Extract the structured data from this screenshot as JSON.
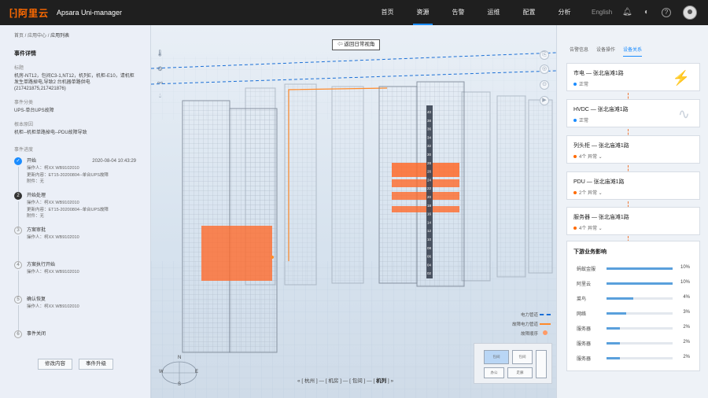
{
  "app": {
    "logo_mark": "[-]",
    "logo_text": "阿里云",
    "product": "Apsara Uni-manager"
  },
  "nav": [
    {
      "label": "首页",
      "active": false
    },
    {
      "label": "资源",
      "active": true
    },
    {
      "label": "告警",
      "active": false
    },
    {
      "label": "运维",
      "active": false
    },
    {
      "label": "配置",
      "active": false
    },
    {
      "label": "分析",
      "active": false
    }
  ],
  "top": {
    "language": "English",
    "bell_icon": "bell-icon",
    "theme_icon": "theme-icon",
    "help_icon": "help-icon"
  },
  "left": {
    "breadcrumb": [
      "首页",
      "应用中心",
      "应用列表"
    ],
    "event_title": "事件详情",
    "tag_label": "标题",
    "tag_value": "机房-NT12，包间C3-1,NT12，机列E，机柜-E10，请机柜发生单路掉电,导致2 台机器单路供电 (217421875,217421876)",
    "cat_label": "事件分类",
    "cat_value": "UPS-单台UPS故障",
    "cause_label": "根本原因",
    "cause_value": "机柜--机柜单路掉电--PDU故障导致",
    "progress_label": "事件进度",
    "steps": [
      {
        "num": "✓",
        "title": "开始",
        "time": "2020-08-04 10:43:29",
        "lines": [
          "操作人：柯XX WB9102010",
          "更新内容：ET15-20200804--单台UPS故障",
          "附件：无"
        ]
      },
      {
        "num": "2",
        "title": "开始处理",
        "time": "",
        "lines": [
          "操作人：柯XX WB9102010",
          "更新内容：ET15-20200804--单台UPS故障",
          "附件：无"
        ]
      },
      {
        "num": "3",
        "title": "方案审批",
        "time": "",
        "lines": [
          "操作人：柯XX WB9102010"
        ]
      },
      {
        "num": "4",
        "title": "方案执行开始",
        "time": "",
        "lines": [
          "操作人：柯XX WB9102010"
        ]
      },
      {
        "num": "5",
        "title": "确认恢复",
        "time": "",
        "lines": [
          "操作人：柯XX WB9102010"
        ]
      },
      {
        "num": "6",
        "title": "事件关闭",
        "time": "",
        "lines": []
      }
    ],
    "edit_button": "修改内容",
    "upgrade_button": "事件升级"
  },
  "scene": {
    "back_button": "返回日常视角",
    "legend": [
      {
        "label": "电力管道",
        "color": "#1a6fd6"
      },
      {
        "label": "故障电力管道",
        "color": "#ff8a2a"
      },
      {
        "label": "故障顺序",
        "color": "#ff9a66"
      }
    ],
    "rack_units": [
      "40",
      "38",
      "36",
      "34",
      "32",
      "30",
      "28",
      "26",
      "24",
      "22",
      "20",
      "18",
      "16",
      "14",
      "12",
      "10",
      "08",
      "06",
      "04",
      "02"
    ],
    "path_segments": [
      "杭州",
      "机房",
      "包间",
      "机列"
    ],
    "minimap": {
      "room1": "包间",
      "room2": "包间",
      "room3": "走廊",
      "room4": "办公"
    },
    "compass": {
      "n": "N",
      "s": "S",
      "e": "E",
      "w": "W"
    }
  },
  "right": {
    "tabs": [
      {
        "label": "告警信息",
        "active": false
      },
      {
        "label": "设备操作",
        "active": false
      },
      {
        "label": "设备关系",
        "active": true
      }
    ],
    "cards": [
      {
        "title": "市电 — 张北庙滩1路",
        "status": "正常",
        "dot": "#1a8cff",
        "icon": "⚡"
      },
      {
        "title": "HVDC — 张北庙滩1路",
        "status": "正常",
        "dot": "#1a8cff",
        "icon": "∿"
      },
      {
        "title": "列头柜 — 张北庙滩1路",
        "status": "4个 异常 ⌄",
        "dot": "#ff6a00",
        "icon": ""
      },
      {
        "title": "PDU — 张北庙滩1路",
        "status": "2个 异常 ⌄",
        "dot": "#ff6a00",
        "icon": ""
      },
      {
        "title": "服务器 — 张北庙滩1路",
        "status": "4个 异常 ⌄",
        "dot": "#ff6a00",
        "icon": ""
      }
    ],
    "impact_title": "下游业务影响",
    "impact": [
      {
        "name": "蚂蚁金服",
        "pct": "10%",
        "value": 10
      },
      {
        "name": "阿里云",
        "pct": "10%",
        "value": 10
      },
      {
        "name": "菜鸟",
        "pct": "4%",
        "value": 4
      },
      {
        "name": "网络",
        "pct": "3%",
        "value": 3
      },
      {
        "name": "服务器",
        "pct": "2%",
        "value": 2
      },
      {
        "name": "服务器",
        "pct": "2%",
        "value": 2
      },
      {
        "name": "服务器",
        "pct": "2%",
        "value": 2
      }
    ]
  }
}
